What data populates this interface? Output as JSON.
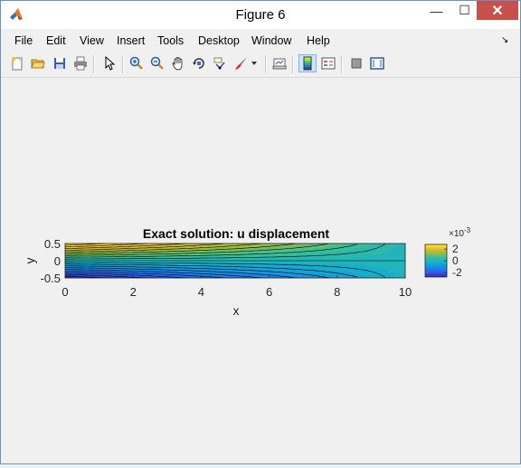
{
  "window": {
    "title": "Figure 6",
    "minimize_glyph": "—",
    "maximize_glyph": "☐",
    "close_glyph": "✕"
  },
  "menu": {
    "items": [
      "File",
      "Edit",
      "View",
      "Insert",
      "Tools",
      "Desktop",
      "Window",
      "Help"
    ],
    "overflow_glyph": "↘"
  },
  "toolbar": {
    "icons": [
      "new-figure-icon",
      "open-file-icon",
      "save-icon",
      "print-icon",
      "pointer-icon",
      "zoom-in-icon",
      "zoom-out-icon",
      "pan-icon",
      "rotate-3d-icon",
      "data-cursor-icon",
      "brush-icon",
      "brush-dropdown-icon",
      "link-plot-icon",
      "colorbar-icon",
      "legend-icon",
      "hide-plot-tools-icon",
      "show-plot-tools-icon"
    ],
    "active": "colorbar-icon"
  },
  "chart_data": {
    "type": "heatmap",
    "subtype": "filled-contour",
    "title": "Exact solution: u displacement",
    "xlabel": "x",
    "ylabel": "y",
    "xlim": [
      0,
      10
    ],
    "ylim": [
      -0.5,
      0.5
    ],
    "xticks": [
      "0",
      "2",
      "4",
      "6",
      "8",
      "10"
    ],
    "yticks": [
      "0.5",
      "0",
      "-0.5"
    ],
    "colorbar": {
      "exponent_label": "×10",
      "exponent_power": "-3",
      "ticks": [
        "2",
        "0",
        "-2"
      ],
      "range": [
        -0.0028,
        0.0028
      ],
      "colormap": "parula"
    },
    "description_values": {
      "top_edge_max": 0.0028,
      "bottom_edge_min": -0.0028,
      "right_end_value": 0.0
    },
    "grid": false
  },
  "colors": {
    "window_border": "#6d8fb8",
    "close_button": "#c7504b",
    "figure_bg": "#f0f0f0",
    "contour_line": "#000000"
  }
}
